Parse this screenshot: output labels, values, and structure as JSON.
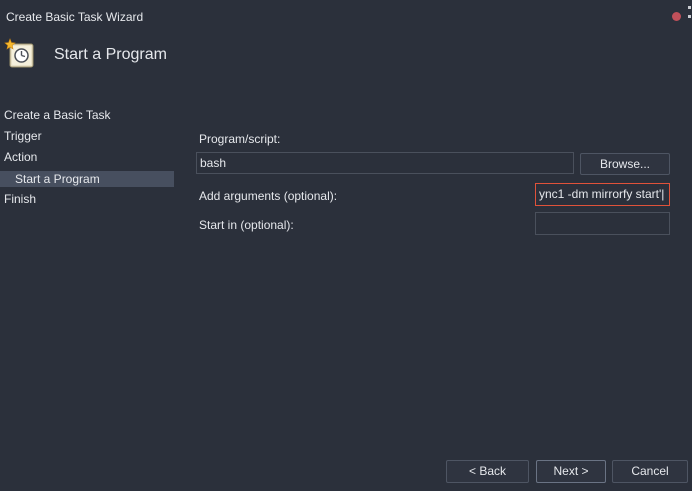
{
  "window": {
    "title": "Create Basic Task Wizard"
  },
  "header": {
    "title": "Start a Program",
    "icon": "task-clock-icon"
  },
  "nav": {
    "items": [
      {
        "label": "Create a Basic Task"
      },
      {
        "label": "Trigger"
      },
      {
        "label": "Action"
      },
      {
        "label": "Start a Program"
      },
      {
        "label": "Finish"
      }
    ]
  },
  "form": {
    "program_label": "Program/script:",
    "program_value": "bash",
    "browse_label": "Browse...",
    "args_label": "Add arguments (optional):",
    "args_value": "ync1 -dm mirrorfy start'|",
    "startin_label": "Start in (optional):",
    "startin_value": ""
  },
  "footer": {
    "back_label": "< Back",
    "next_label": "Next >",
    "cancel_label": "Cancel"
  },
  "colors": {
    "background": "#2b303b",
    "selection": "#474f5f",
    "focus_border": "#e0523a",
    "close_dot": "#c0505a"
  }
}
